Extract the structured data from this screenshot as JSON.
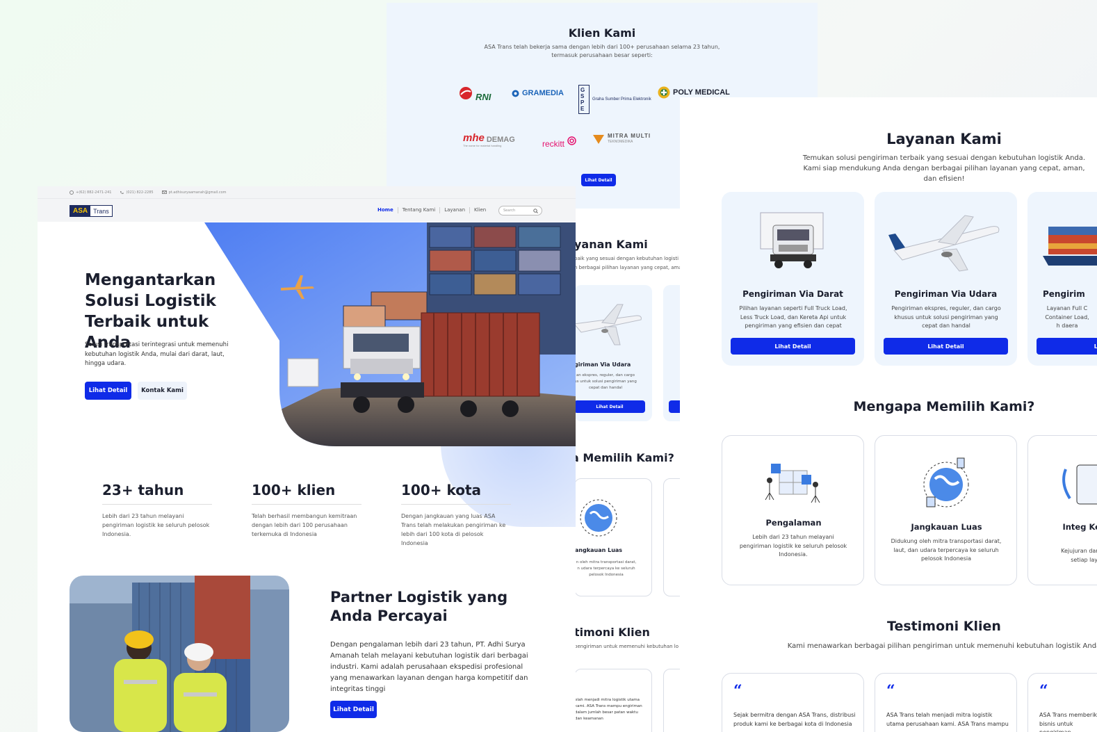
{
  "klien": {
    "title": "Klien Kami",
    "subtitle": "ASA Trans telah bekerja sama dengan lebih dari 100+ perusahaan selama 23 tahun, termasuk perusahaan besar seperti:",
    "logos": [
      "RNI",
      "GRAMEDIA",
      "GSPE",
      "Graha Sumber Prima Elektronik",
      "POLY MEDICAL",
      "mhe",
      "DEMAG",
      "The name for material handling",
      "reckitt",
      "MITRA MULTI",
      "TEKNOMEDIKA"
    ],
    "button": "Lihat Detail"
  },
  "layanan": {
    "title": "Layanan Kami",
    "subtitle": "Temukan solusi pengiriman terbaik yang sesuai dengan kebutuhan logistik Anda. Kami siap mendukung Anda dengan berbagai pilihan layanan yang cepat, aman, dan efisien!",
    "subtitle_back_1": "baik yang sesuai dengan kebutuhan logisti",
    "subtitle_back_2": "n berbagai pilihan layanan yang cepat, aman",
    "title_back": "yanan Kami",
    "services": [
      {
        "name": "Pengiriman Via Darat",
        "desc": "Pilihan layanan seperti Full Truck Load, Less Truck Load, dan Kereta Api untuk pengiriman yang efisien dan cepat",
        "button": "Lihat Detail"
      },
      {
        "name": "Pengiriman Via Udara",
        "desc": "Pengiriman ekspres, reguler, dan cargo khusus untuk solusi pengiriman yang cepat dan handal",
        "button": "Lihat Detail"
      },
      {
        "name": "Pengirim",
        "desc": "Layanan Full C Container Load, h daera",
        "button": "Lih"
      }
    ],
    "back_card": {
      "name": "giriman Via Udara",
      "desc": "an ekspres, reguler, dan cargo us untuk solusi pengiriman yang cepat dan handal",
      "button": "Lihat Detail"
    }
  },
  "mengapa": {
    "title": "Mengapa Memilih Kami?",
    "title_back": "a Memilih Kami?",
    "items": [
      {
        "name": "Pengalaman",
        "desc": "Lebih dari 23 tahun melayani pengiriman logistik ke seluruh pelosok Indonesia."
      },
      {
        "name": "Jangkauan Luas",
        "desc": "Didukung oleh mitra transportasi darat, laut, dan udara terpercaya ke seluruh pelosok Indonesia"
      },
      {
        "name": "Integ Kepe",
        "desc": "Kejujuran dan p setiap layan"
      }
    ],
    "back_item": {
      "name": "angkauan Luas",
      "desc": "n oleh mitra transportasi darat, n udara terpercaya ke seluruh pelosok Indonesia"
    }
  },
  "testimoni": {
    "title": "Testimoni Klien",
    "title_back": "timoni Klien",
    "subtitle": "Kami menawarkan berbagai pilihan pengiriman untuk memenuhi kebutuhan logistik Anda",
    "subtitle_back": "pengiriman untuk memenuhi kebutuhan lo",
    "quote_mark": "“",
    "items": [
      "Sejak bermitra dengan ASA Trans, distribusi produk kami ke berbagai kota di Indonesia",
      "ASA Trans telah menjadi mitra logistik utama perusahaan kami. ASA Trans mampu",
      "ASA Trans memberik bisnis untuk pengiriman"
    ],
    "back_item": "elah menjadi mitra logistik utama kami. ASA Trans mampu engiriman dalam jumlah besar patan waktu dan keamanan"
  },
  "home": {
    "topbar": {
      "whatsapp": "+(62) 882-2471-241",
      "phone": "(021) 822-2285",
      "email": "pt.adhisuryaamanah@gmail.com"
    },
    "logo": {
      "asa": "ASA",
      "trans": "Trans"
    },
    "nav": [
      "Home",
      "Tentang Kami",
      "Layanan",
      "Klien"
    ],
    "search_placeholder": "Search",
    "hero": {
      "title": "Mengantarkan Solusi Logistik Terbaik untuk Anda",
      "subtitle": "Solusi transportasi terintegrasi untuk memenuhi kebutuhan logistik Anda, mulai dari darat, laut, hingga udara.",
      "primary": "Lihat Detail",
      "secondary": "Kontak Kami"
    },
    "stats": [
      {
        "num": "23+ tahun",
        "text": "Lebih dari 23 tahun melayani pengiriman logistik ke seluruh pelosok Indonesia."
      },
      {
        "num": "100+ klien",
        "text": "Telah berhasil membangun kemitraan dengan lebih dari 100 perusahaan terkemuka di Indonesia"
      },
      {
        "num": "100+ kota",
        "text": "Dengan jangkauan yang luas ASA Trans telah melakukan pengiriman ke lebih dari 100 kota di pelosok Indonesia"
      }
    ],
    "partner": {
      "title": "Partner Logistik yang Anda Percayai",
      "text": "Dengan pengalaman lebih dari 23 tahun, PT. Adhi Surya Amanah telah melayani kebutuhan logistik dari berbagai industri. Kami adalah perusahaan ekspedisi profesional yang menawarkan layanan dengan harga kompetitif dan integritas tinggi",
      "button": "Lihat Detail"
    }
  },
  "colors": {
    "primary": "#0f2be8",
    "light_bg": "#eef5fd",
    "navy": "#1c2a5e",
    "yellow": "#f5c400"
  }
}
